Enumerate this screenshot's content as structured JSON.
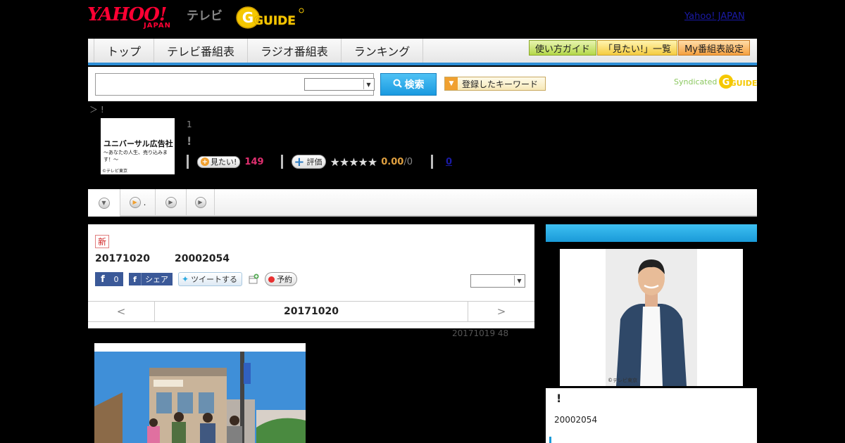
{
  "header": {
    "yahoo_logo": "YAHOO!",
    "yahoo_sub": "JAPAN",
    "tv_label": "テレビ",
    "gguide_logo": "GUIDE",
    "top_link": "Yahoo! JAPAN"
  },
  "nav": {
    "items": [
      "トップ",
      "テレビ番組表",
      "ラジオ番組表",
      "ランキング"
    ],
    "right_buttons": [
      "使い方ガイド",
      "「見たい!」一覧",
      "My番組表設定"
    ]
  },
  "search": {
    "input_value": "",
    "select_value": "",
    "button_label": "検索",
    "keyword_button": "登録したキーワード",
    "syndicated_label": "Syndicated",
    "syndicated_logo": "GUIDE"
  },
  "breadcrumb": "＞ !",
  "program": {
    "thumb_title": "ユニバーサル広告社",
    "thumb_subtitle": "～あなたの人生、売り込みます！～",
    "thumb_copyright": "©テレビ東京",
    "episode_number": "1",
    "title": "!",
    "mitai_label": "見たい!",
    "mitai_count": "149",
    "hyoka_label": "評価",
    "stars": "★★★★★",
    "score": "0.00",
    "score_den": "/0",
    "review_count": "0"
  },
  "tabs": [
    {
      "label": ""
    },
    {
      "label": "."
    },
    {
      "label": ""
    },
    {
      "label": ""
    }
  ],
  "episode": {
    "new_badge": "新",
    "date": "20171020",
    "time": "20002054",
    "fb_like_count": "0",
    "fb_share_label": "シェア",
    "tweet_label": "ツイートする",
    "reserve_label": "予約",
    "select_value": "",
    "nav_prev": "<",
    "nav_current": "20171020",
    "nav_next": ">",
    "updated": "20171019  48"
  },
  "right": {
    "image_copyright": "©テレビ東京",
    "name": "!",
    "time": "20002054"
  },
  "colors": {
    "accent_blue": "#2e8ed6",
    "pink_count": "#e03070",
    "score_orange": "#e0a040"
  }
}
